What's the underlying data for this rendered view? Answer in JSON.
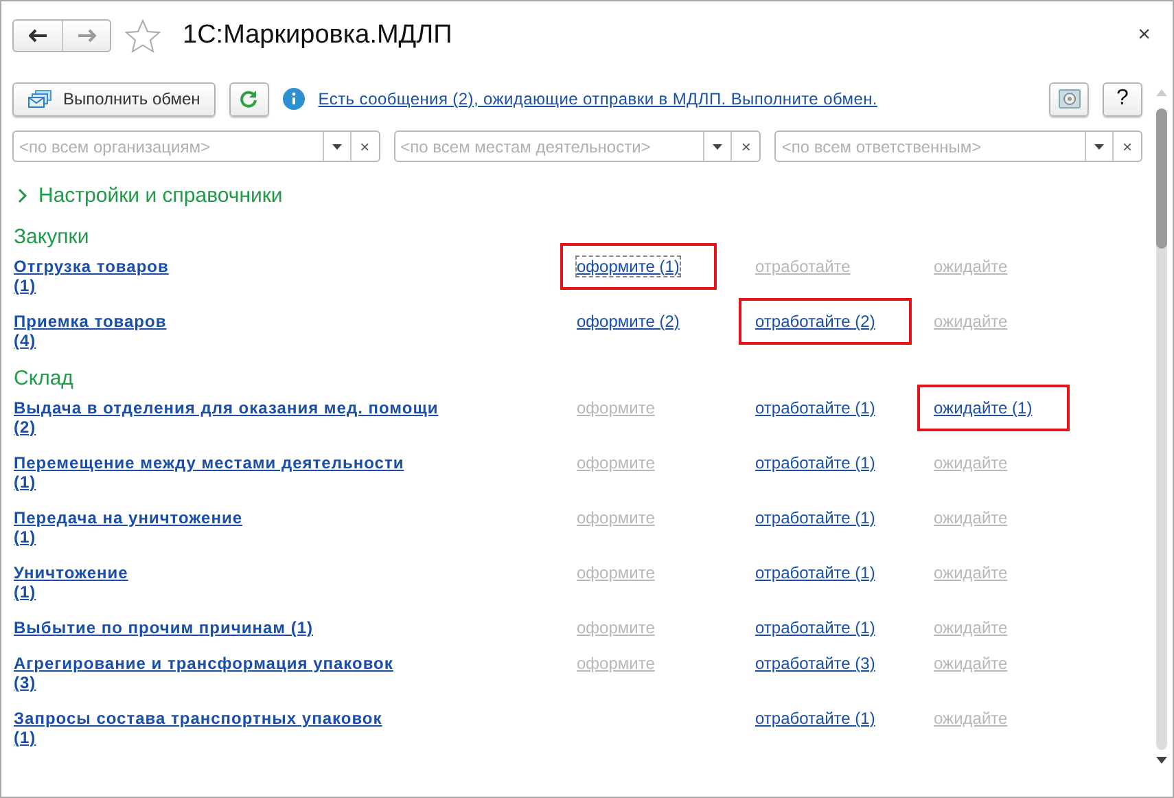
{
  "window": {
    "title": "1С:Маркировка.МДЛП",
    "close": "×"
  },
  "toolbar": {
    "exchange_button": "Выполнить обмен",
    "message_link": "Есть сообщения (2), ожидающие отправки в МДЛП. Выполните обмен.",
    "help_button": "?"
  },
  "filters": [
    {
      "placeholder": "<по всем организациям>",
      "clear": "×"
    },
    {
      "placeholder": "<по всем местам деятельности>",
      "clear": "×"
    },
    {
      "placeholder": "<по всем ответственным>",
      "clear": "×"
    }
  ],
  "settings_group": {
    "label": "Настройки и справочники",
    "expanded": false
  },
  "sections": [
    {
      "title": "Закупки",
      "rows": [
        {
          "name": "Отгрузка товаров\n(1)",
          "action_1": {
            "text": "оформите (1)",
            "active": true,
            "highlighted": true,
            "focused": true
          },
          "action_2": {
            "text": "отработайте",
            "active": false,
            "highlighted": false,
            "focused": false
          },
          "action_3": {
            "text": "ожидайте",
            "active": false,
            "highlighted": false,
            "focused": false
          }
        },
        {
          "name": "Приемка товаров\n(4)",
          "action_1": {
            "text": "оформите (2)",
            "active": true,
            "highlighted": false,
            "focused": false
          },
          "action_2": {
            "text": "отработайте (2)",
            "active": true,
            "highlighted": true,
            "focused": false
          },
          "action_3": {
            "text": "ожидайте",
            "active": false,
            "highlighted": false,
            "focused": false
          }
        }
      ]
    },
    {
      "title": "Склад",
      "rows": [
        {
          "name": "Выдача в отделения для оказания мед. помощи\n(2)",
          "action_1": {
            "text": "оформите",
            "active": false,
            "highlighted": false,
            "focused": false
          },
          "action_2": {
            "text": "отработайте (1)",
            "active": true,
            "highlighted": false,
            "focused": false
          },
          "action_3": {
            "text": "ожидайте (1)",
            "active": true,
            "highlighted": true,
            "focused": false
          }
        },
        {
          "name": "Перемещение между местами деятельности\n(1)",
          "action_1": {
            "text": "оформите",
            "active": false,
            "highlighted": false,
            "focused": false
          },
          "action_2": {
            "text": "отработайте (1)",
            "active": true,
            "highlighted": false,
            "focused": false
          },
          "action_3": {
            "text": "ожидайте",
            "active": false,
            "highlighted": false,
            "focused": false
          }
        },
        {
          "name": "Передача на уничтожение\n(1)",
          "action_1": {
            "text": "оформите",
            "active": false,
            "highlighted": false,
            "focused": false
          },
          "action_2": {
            "text": "отработайте (1)",
            "active": true,
            "highlighted": false,
            "focused": false
          },
          "action_3": {
            "text": "ожидайте",
            "active": false,
            "highlighted": false,
            "focused": false
          }
        },
        {
          "name": "Уничтожение\n(1)",
          "action_1": {
            "text": "оформите",
            "active": false,
            "highlighted": false,
            "focused": false
          },
          "action_2": {
            "text": "отработайте (1)",
            "active": true,
            "highlighted": false,
            "focused": false
          },
          "action_3": {
            "text": "ожидайте",
            "active": false,
            "highlighted": false,
            "focused": false
          }
        },
        {
          "name": "Выбытие по прочим причинам (1)",
          "action_1": {
            "text": "оформите",
            "active": false,
            "highlighted": false,
            "focused": false
          },
          "action_2": {
            "text": "отработайте (1)",
            "active": true,
            "highlighted": false,
            "focused": false
          },
          "action_3": {
            "text": "ожидайте",
            "active": false,
            "highlighted": false,
            "focused": false
          }
        },
        {
          "name": "Агрегирование и трансформация упаковок\n(3)",
          "action_1": {
            "text": "оформите",
            "active": false,
            "highlighted": false,
            "focused": false
          },
          "action_2": {
            "text": "отработайте (3)",
            "active": true,
            "highlighted": false,
            "focused": false
          },
          "action_3": {
            "text": "ожидайте",
            "active": false,
            "highlighted": false,
            "focused": false
          }
        },
        {
          "name": "Запросы состава транспортных упаковок\n(1)",
          "action_2": {
            "text": "отработайте (1)",
            "active": true,
            "highlighted": false,
            "focused": false
          },
          "action_3": {
            "text": "ожидайте",
            "active": false,
            "highlighted": false,
            "focused": false
          }
        }
      ]
    }
  ]
}
